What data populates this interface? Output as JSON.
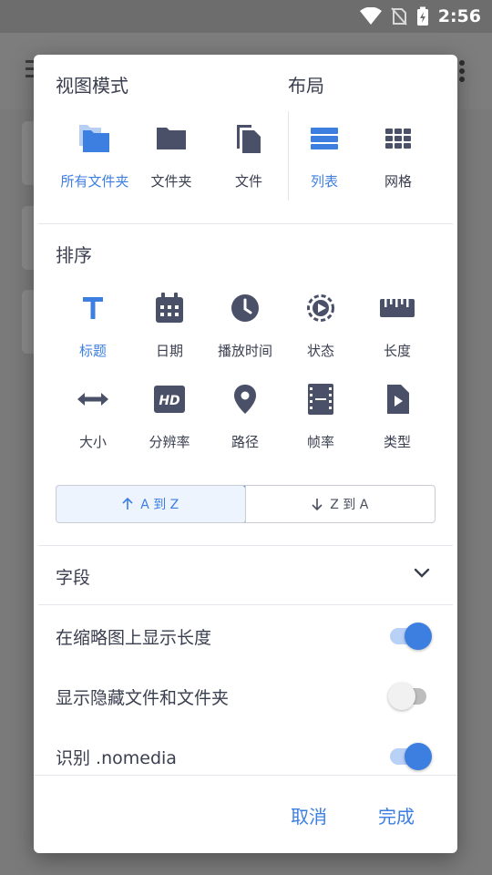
{
  "status_bar": {
    "time": "2:56"
  },
  "dialog": {
    "view_mode": {
      "title": "视图模式",
      "items": [
        {
          "label": "所有文件夹",
          "icon": "all-folders-icon",
          "selected": true
        },
        {
          "label": "文件夹",
          "icon": "folder-icon",
          "selected": false
        },
        {
          "label": "文件",
          "icon": "files-icon",
          "selected": false
        }
      ]
    },
    "layout": {
      "title": "布局",
      "items": [
        {
          "label": "列表",
          "icon": "list-icon",
          "selected": true
        },
        {
          "label": "网格",
          "icon": "grid-icon",
          "selected": false
        }
      ]
    },
    "sort": {
      "title": "排序",
      "items": [
        {
          "label": "标题",
          "icon": "title-icon",
          "selected": true
        },
        {
          "label": "日期",
          "icon": "calendar-icon",
          "selected": false
        },
        {
          "label": "播放时间",
          "icon": "clock-icon",
          "selected": false
        },
        {
          "label": "状态",
          "icon": "play-status-icon",
          "selected": false
        },
        {
          "label": "长度",
          "icon": "ruler-icon",
          "selected": false
        },
        {
          "label": "大小",
          "icon": "size-icon",
          "selected": false
        },
        {
          "label": "分辨率",
          "icon": "hd-icon",
          "selected": false
        },
        {
          "label": "路径",
          "icon": "location-icon",
          "selected": false
        },
        {
          "label": "帧率",
          "icon": "film-icon",
          "selected": false
        },
        {
          "label": "类型",
          "icon": "file-type-icon",
          "selected": false
        }
      ],
      "direction": {
        "asc_label": "A 到 Z",
        "desc_label": "Z 到 A",
        "selected": "asc"
      }
    },
    "fields": {
      "label": "字段"
    },
    "toggles": [
      {
        "label": "在缩略图上显示长度",
        "on": true
      },
      {
        "label": "显示隐藏文件和文件夹",
        "on": false
      },
      {
        "label": "识别 .nomedia",
        "on": true
      }
    ],
    "actions": {
      "cancel": "取消",
      "done": "完成"
    }
  },
  "colors": {
    "accent": "#3d7fe0",
    "icon_default": "#4a5068",
    "text": "#3a3f4f"
  }
}
